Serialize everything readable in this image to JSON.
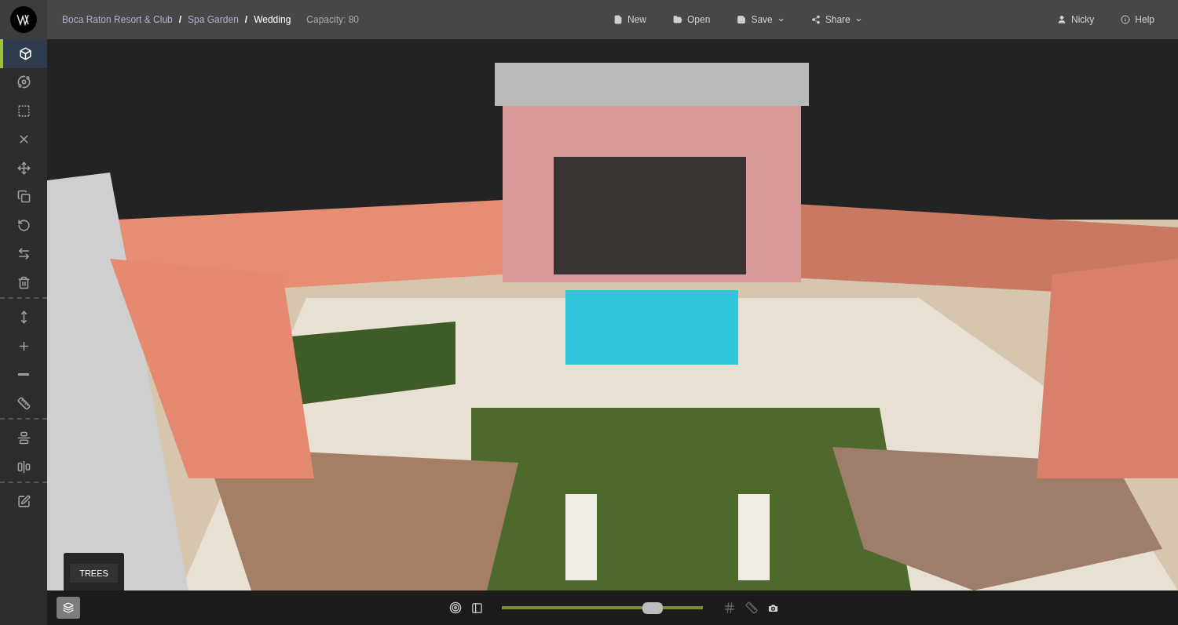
{
  "breadcrumb": [
    {
      "label": "Boca Raton Resort & Club",
      "current": false
    },
    {
      "label": "Spa Garden",
      "current": false
    },
    {
      "label": "Wedding",
      "current": true
    }
  ],
  "separator": "/",
  "capacity": "Capacity: 80",
  "menu": [
    {
      "label": "New",
      "has_menu": false
    },
    {
      "label": "Open",
      "has_menu": false
    },
    {
      "label": "Save",
      "has_menu": true
    },
    {
      "label": "Share",
      "has_menu": true
    }
  ],
  "user": "Nicky",
  "help": "Help",
  "sidebar": {
    "groups": [
      [
        {
          "selected": true
        },
        {
          "selected": false
        },
        {
          "selected": false
        },
        {
          "selected": false
        },
        {
          "selected": false
        },
        {
          "selected": false
        },
        {
          "selected": false
        },
        {
          "selected": false
        },
        {
          "selected": false
        }
      ],
      [
        {
          "selected": false
        },
        {
          "selected": false
        },
        {
          "selected": false
        },
        {
          "selected": false
        }
      ],
      [
        {
          "selected": false
        },
        {
          "selected": false
        }
      ],
      [
        {
          "selected": false
        }
      ]
    ]
  },
  "tooltip": "TREES",
  "zoom": {
    "level": 0.78
  }
}
